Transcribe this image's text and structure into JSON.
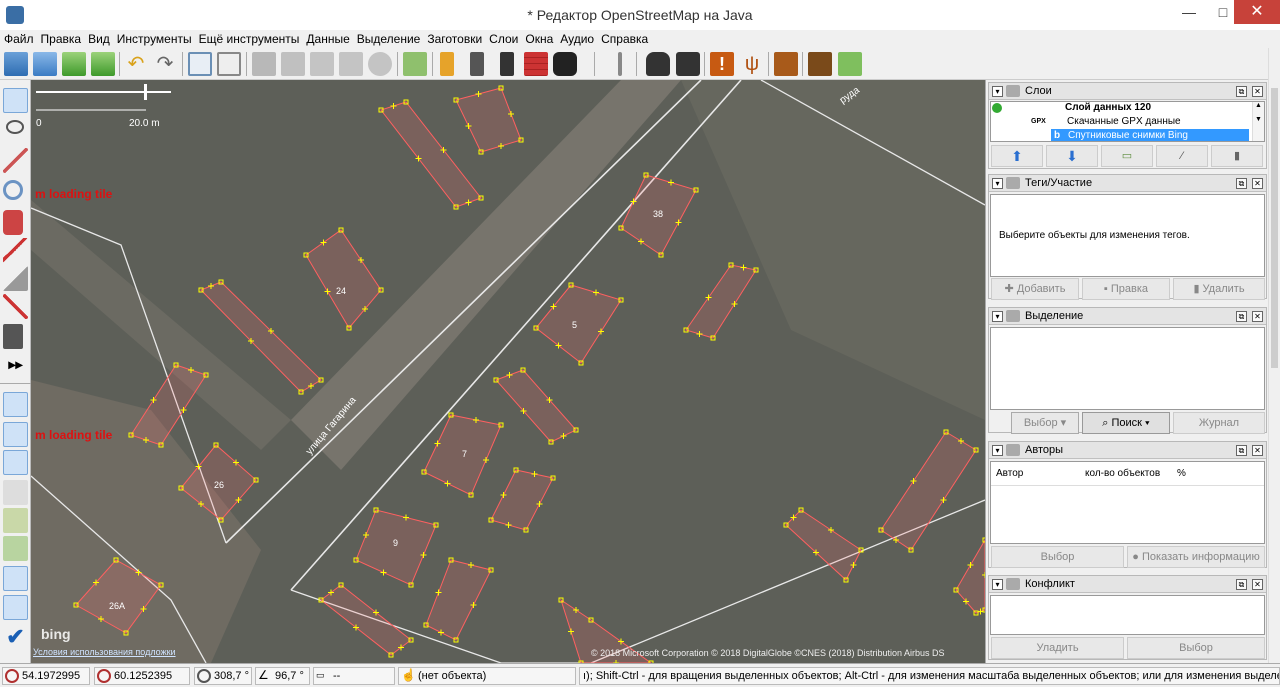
{
  "window": {
    "title": "* Редактор OpenStreetMap на Java",
    "min": "—",
    "max": "□",
    "close": "✕"
  },
  "menu": [
    "Файл",
    "Правка",
    "Вид",
    "Инструменты",
    "Ещё инструменты",
    "Данные",
    "Выделение",
    "Заготовки",
    "Слои",
    "Окна",
    "Аудио",
    "Справка"
  ],
  "map": {
    "scale_left": "0",
    "scale_right": "20.0 m",
    "loading_1": "m loading tile",
    "loading_2": "m loading tile",
    "street": "улица Гагарина",
    "street_top": "руда",
    "labels": {
      "b24": "24",
      "b26": "26",
      "b26a": "26А",
      "b38": "38",
      "b5": "5",
      "b7": "7",
      "b9": "9"
    },
    "bing": "bing",
    "terms": "Условия использования подложки",
    "attribution": "© 2018 Microsoft Corporation © 2018 DigitalGlobe ©CNES (2018) Distribution Airbus DS"
  },
  "layers_panel": {
    "title": "Слои",
    "items": [
      {
        "name": "Слой данных 120",
        "bold": true
      },
      {
        "name": "Скачанные GPX данные",
        "prefix": "GPX"
      },
      {
        "name": "Спутниковые снимки Bing",
        "selected": true
      }
    ]
  },
  "tags_panel": {
    "title": "Теги/Участие",
    "empty": "Выберите объекты для изменения тегов.",
    "add": "Добавить",
    "edit": "Правка",
    "delete": "Удалить"
  },
  "selection_panel": {
    "title": "Выделение",
    "select": "Выбор",
    "search": "Поиск",
    "journal": "Журнал"
  },
  "authors_panel": {
    "title": "Авторы",
    "col_author": "Автор",
    "col_count": "кол-во объектов",
    "col_pct": "%",
    "select": "Выбор",
    "show_info": "Показать информацию"
  },
  "conflict_panel": {
    "title": "Конфликт",
    "resolve": "Уладить",
    "select": "Выбор"
  },
  "status": {
    "lat": "54.1972995",
    "lon": "60.1252395",
    "heading": "308,7 °",
    "angle": "96,7 °",
    "distance": "--",
    "object": "(нет объекта)",
    "help": "ı); Shift-Ctrl - для вращения выделенных объектов; Alt-Ctrl - для изменения масштаба выделенных объектов; или для изменения выделения"
  },
  "colors": {
    "accent": "#3399ff",
    "way": "#ff6060",
    "node": "#ffff00",
    "road": "#e8e8e8"
  }
}
